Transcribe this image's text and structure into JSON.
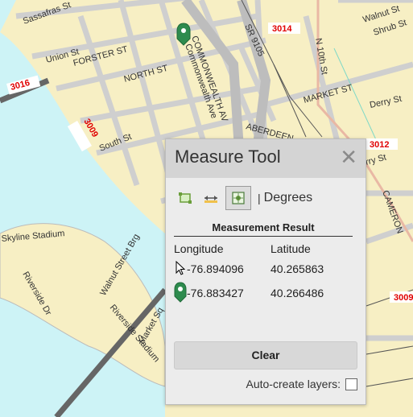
{
  "map": {
    "streets": [
      {
        "name": "Sassafras St"
      },
      {
        "name": "Union St"
      },
      {
        "name": "FORSTER ST"
      },
      {
        "name": "NORTH ST"
      },
      {
        "name": "COMMONWEALTH AV"
      },
      {
        "name": "Commonwealth Ave"
      },
      {
        "name": "SR 9105"
      },
      {
        "name": "N 10th St"
      },
      {
        "name": "MARKET ST"
      },
      {
        "name": "Derry St"
      },
      {
        "name": "Walnut St"
      },
      {
        "name": "Shrub St"
      },
      {
        "name": "South St"
      },
      {
        "name": "ABERDEEN"
      },
      {
        "name": "Skyline Stadium"
      },
      {
        "name": "Riverside Dr"
      },
      {
        "name": "Walnut Street Brg"
      },
      {
        "name": "Riverside Stadium"
      },
      {
        "name": "Market Sq"
      },
      {
        "name": "CAMERON"
      },
      {
        "name": "rry St"
      }
    ],
    "routes": [
      "3014",
      "3016",
      "3009",
      "3012",
      "3009"
    ],
    "colors": {
      "land": "#f7efc4",
      "water": "#cdf3f6",
      "roads": "#c9c9c9",
      "rail": "#555555",
      "marker": "#2e8b4e"
    }
  },
  "panel": {
    "title": "Measure Tool",
    "close_icon": "close-icon",
    "tools": [
      {
        "name": "area-tool-icon",
        "active": false
      },
      {
        "name": "distance-tool-icon",
        "active": false
      },
      {
        "name": "location-tool-icon",
        "active": true
      }
    ],
    "separator": "|",
    "units": "Degrees",
    "result_title": "Measurement Result",
    "headers": {
      "longitude": "Longitude",
      "latitude": "Latitude"
    },
    "rows": [
      {
        "icon": "cursor-icon",
        "longitude": "-76.894096",
        "latitude": "40.265863"
      },
      {
        "icon": "marker-icon",
        "longitude": "-76.883427",
        "latitude": "40.266486"
      }
    ],
    "clear_label": "Clear",
    "auto_create_label": "Auto-create layers:",
    "auto_create_checked": false
  }
}
